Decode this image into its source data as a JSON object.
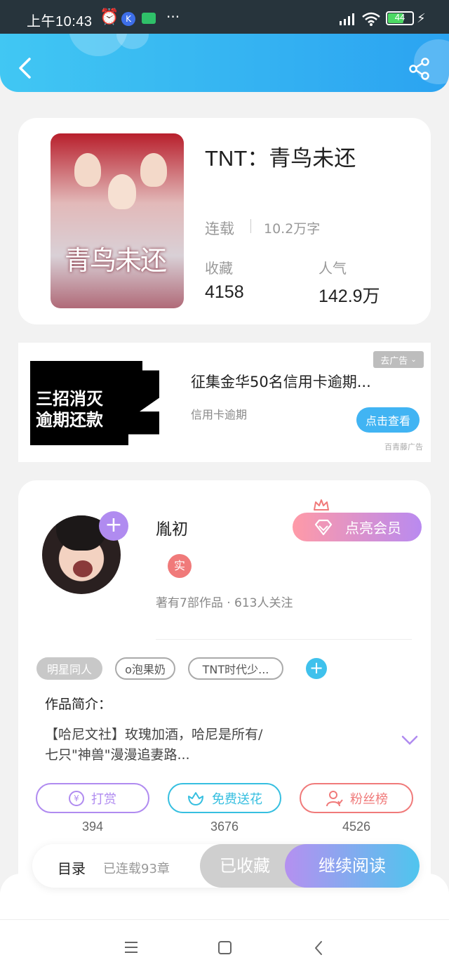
{
  "status_bar": {
    "time": "上午10:43",
    "more": "···",
    "battery": "44"
  },
  "header": {
    "back_icon": "chevron-left-icon",
    "share_icon": "share-icon"
  },
  "book": {
    "cover_title": "青鸟未还",
    "title": "TNT：青鸟未还",
    "status": "连载",
    "word_count": "10.2万字",
    "favorites_label": "收藏",
    "favorites_value": "4158",
    "popularity_label": "人气",
    "popularity_value": "142.9万"
  },
  "ad": {
    "image_line1": "三招消灭",
    "image_line2": "逾期还款",
    "title": "征集金华50名信用卡逾期...",
    "subtitle": "信用卡逾期",
    "remove_label": "去广告",
    "cta": "点击查看",
    "source": "百青藤广告"
  },
  "author": {
    "name": "胤初",
    "verified_badge": "实",
    "stats": "著有7部作品 · 613人关注",
    "vip_button": "点亮会员"
  },
  "tags": [
    "明星同人",
    "o泡果奶",
    "TNT时代少..."
  ],
  "intro": {
    "label": "作品简介：",
    "line1": "【哈尼文社】玫瑰加酒，哈尼是所有/",
    "line2": "七只\"神兽\"漫漫追妻路..."
  },
  "actions": {
    "reward_label": "打赏",
    "reward_count": "394",
    "flower_label": "免费送花",
    "flower_count": "3676",
    "fans_label": "粉丝榜",
    "fans_count": "4526"
  },
  "bottom_bar": {
    "toc_label": "目录",
    "chapters": "已连载93章",
    "collected": "已收藏",
    "continue": "继续阅读"
  },
  "colors": {
    "header_start": "#41c7f3",
    "header_end": "#2ba3f1",
    "accent_purple": "#b08bf0",
    "accent_cyan": "#36bfe0",
    "accent_red": "#f07a7a"
  }
}
